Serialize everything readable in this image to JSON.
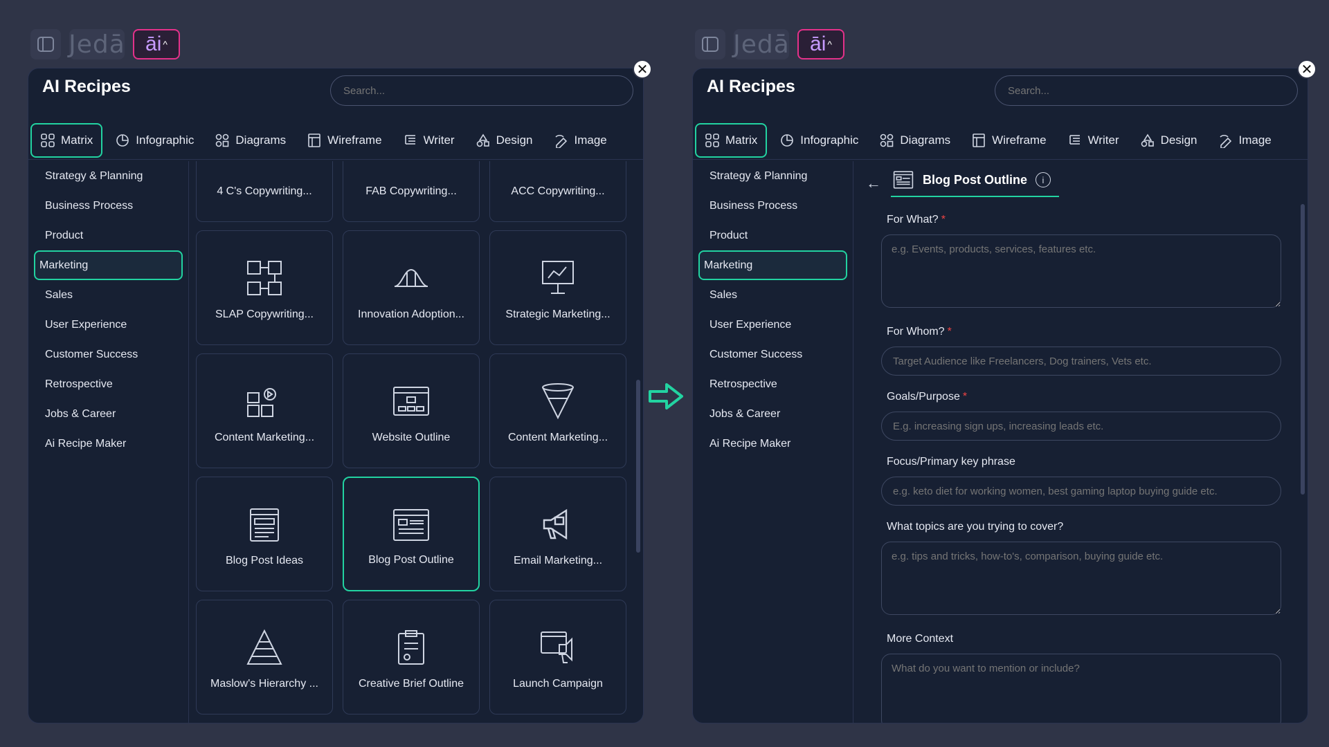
{
  "left": {
    "topbar": {
      "logo_text": "Jedā",
      "ai_text": "āi",
      "ai_caret": "^"
    },
    "title": "AI Recipes",
    "search_placeholder": "Search...",
    "tabs": [
      {
        "label": "Matrix",
        "icon": "grid-icon"
      },
      {
        "label": "Infographic",
        "icon": "pie-icon"
      },
      {
        "label": "Diagrams",
        "icon": "diagram-icon"
      },
      {
        "label": "Wireframe",
        "icon": "wireframe-icon"
      },
      {
        "label": "Writer",
        "icon": "writer-icon"
      },
      {
        "label": "Design",
        "icon": "design-icon"
      },
      {
        "label": "Image",
        "icon": "image-icon"
      }
    ],
    "sidebar": [
      "Strategy & Planning",
      "Business Process",
      "Product",
      "Marketing",
      "Sales",
      "User Experience",
      "Customer Success",
      "Retrospective",
      "Jobs & Career",
      "Ai Recipe Maker"
    ],
    "cards": [
      "4 C's Copywriting...",
      "FAB Copywriting...",
      "ACC Copywriting...",
      "SLAP Copywriting...",
      "Innovation Adoption...",
      "Strategic Marketing...",
      "Content Marketing...",
      "Website Outline",
      "Content Marketing...",
      "Blog Post Ideas",
      "Blog Post Outline",
      "Email Marketing...",
      "Maslow's Hierarchy ...",
      "Creative Brief Outline",
      "Launch Campaign"
    ]
  },
  "right": {
    "topbar": {
      "logo_text": "Jedā",
      "ai_text": "āi",
      "ai_caret": "^"
    },
    "title": "AI Recipes",
    "search_placeholder": "Search...",
    "tabs": [
      {
        "label": "Matrix"
      },
      {
        "label": "Infographic"
      },
      {
        "label": "Diagrams"
      },
      {
        "label": "Wireframe"
      },
      {
        "label": "Writer"
      },
      {
        "label": "Design"
      },
      {
        "label": "Image"
      }
    ],
    "sidebar": [
      "Strategy & Planning",
      "Business Process",
      "Product",
      "Marketing",
      "Sales",
      "User Experience",
      "Customer Success",
      "Retrospective",
      "Jobs & Career",
      "Ai Recipe Maker"
    ],
    "form": {
      "back": "←",
      "title": "Blog Post Outline",
      "info": "i",
      "fields": [
        {
          "label": "For What?",
          "required": "*",
          "placeholder": "e.g. Events, products, services, features etc."
        },
        {
          "label": "For Whom?",
          "required": "*",
          "placeholder": "Target Audience like Freelancers, Dog trainers, Vets etc."
        },
        {
          "label": "Goals/Purpose",
          "required": "*",
          "placeholder": "E.g. increasing sign ups, increasing leads etc."
        },
        {
          "label": "Focus/Primary key phrase",
          "required": "",
          "placeholder": "e.g. keto diet for working women, best gaming laptop buying guide etc."
        },
        {
          "label": "What topics are you trying to cover?",
          "required": "",
          "placeholder": "e.g. tips and tricks, how-to's, comparison, buying guide etc."
        },
        {
          "label": "More Context",
          "required": "",
          "placeholder": "What do you want to mention or include?"
        }
      ]
    }
  },
  "colors": {
    "accent": "#22d3a1",
    "panel": "#172033",
    "background": "#2f3447",
    "ai_border": "#e4318a",
    "required": "#ef4444"
  },
  "close_glyph": "✕"
}
